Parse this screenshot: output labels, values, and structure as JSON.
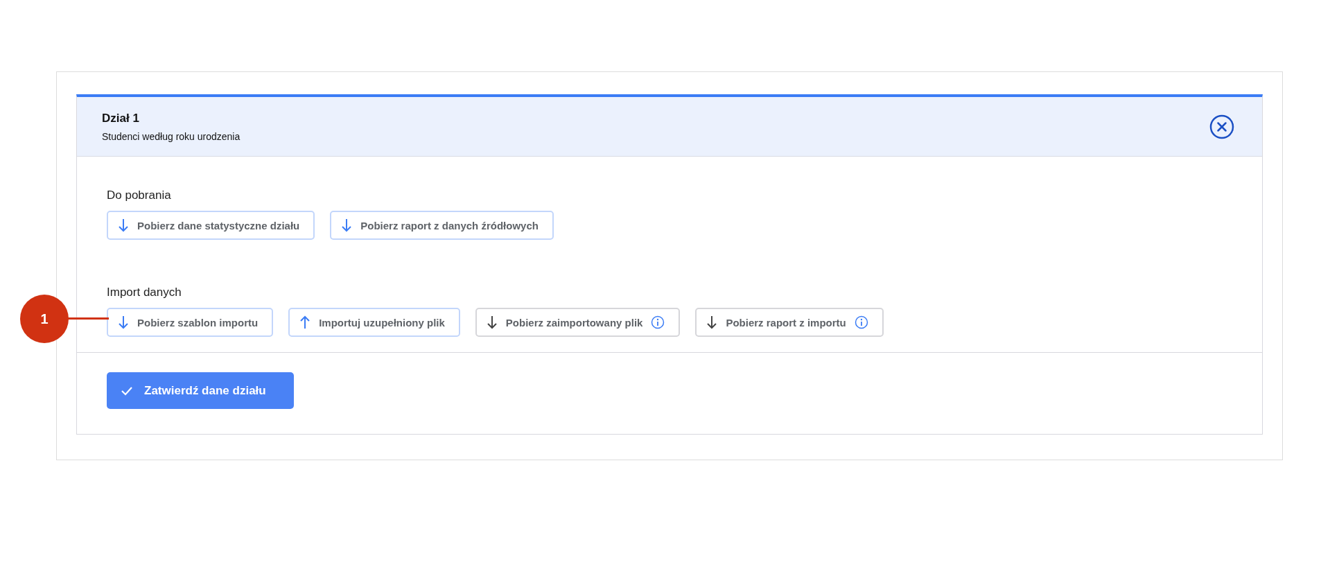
{
  "section": {
    "title": "Dział 1",
    "subtitle": "Studenci według roku urodzenia"
  },
  "groups": [
    {
      "label": "Do pobrania",
      "buttons": [
        {
          "kind": "download",
          "label": "Pobierz dane statystyczne działu",
          "disabled": false,
          "info": false
        },
        {
          "kind": "download",
          "label": "Pobierz raport z danych źródłowych",
          "disabled": false,
          "info": false
        }
      ]
    },
    {
      "label": "Import danych",
      "buttons": [
        {
          "kind": "download",
          "label": "Pobierz szablon importu",
          "disabled": false,
          "info": false
        },
        {
          "kind": "upload",
          "label": "Importuj uzupełniony plik",
          "disabled": false,
          "info": false
        },
        {
          "kind": "download",
          "label": "Pobierz zaimportowany plik",
          "disabled": true,
          "info": true
        },
        {
          "kind": "download",
          "label": "Pobierz raport z importu",
          "disabled": true,
          "info": true
        }
      ]
    }
  ],
  "confirm_button": "Zatwierdź dane działu",
  "callout": "1"
}
